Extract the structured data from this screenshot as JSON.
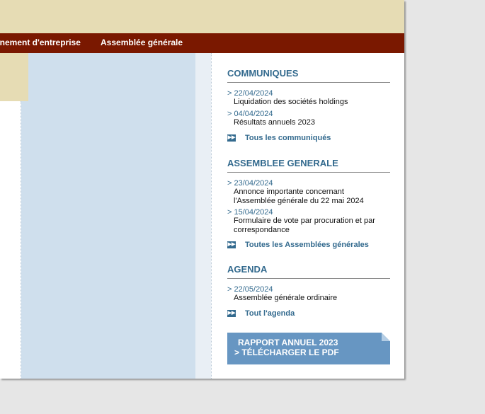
{
  "nav": {
    "items": [
      "rnement d'entreprise",
      "Assemblée générale"
    ]
  },
  "communiques": {
    "title": "COMMUNIQUES",
    "items": [
      {
        "date": "> 22/04/2024",
        "text": "Liquidation des sociétés holdings"
      },
      {
        "date": "> 04/04/2024",
        "text": "Résultats annuels 2023"
      }
    ],
    "more": "Tous les communiqués"
  },
  "assemblee": {
    "title": "ASSEMBLEE GENERALE",
    "items": [
      {
        "date": "> 23/04/2024",
        "line1": "Annonce importante concernant",
        "line2": "l'Assemblée générale du 22 mai 2024"
      },
      {
        "date": "> 15/04/2024",
        "line1": "Formulaire de vote par procuration et par",
        "line2": "correspondance"
      }
    ],
    "more": "Toutes les Assemblées générales"
  },
  "agenda": {
    "title": "AGENDA",
    "items": [
      {
        "date": "> 22/05/2024",
        "text": "Assemblée générale ordinaire"
      }
    ],
    "more": "Tout l'agenda"
  },
  "rapport": {
    "line1": "RAPPORT ANNUEL 2023",
    "line2": ">    TÉLÉCHARGER LE PDF"
  },
  "icons": {
    "more_icon": "double-arrow-right-icon"
  },
  "colors": {
    "nav_bg": "#7a1800",
    "beige": "#e6dcb4",
    "blue_col": "#cfdfed",
    "accent": "#336a8e",
    "button_bg": "#6796c2"
  }
}
